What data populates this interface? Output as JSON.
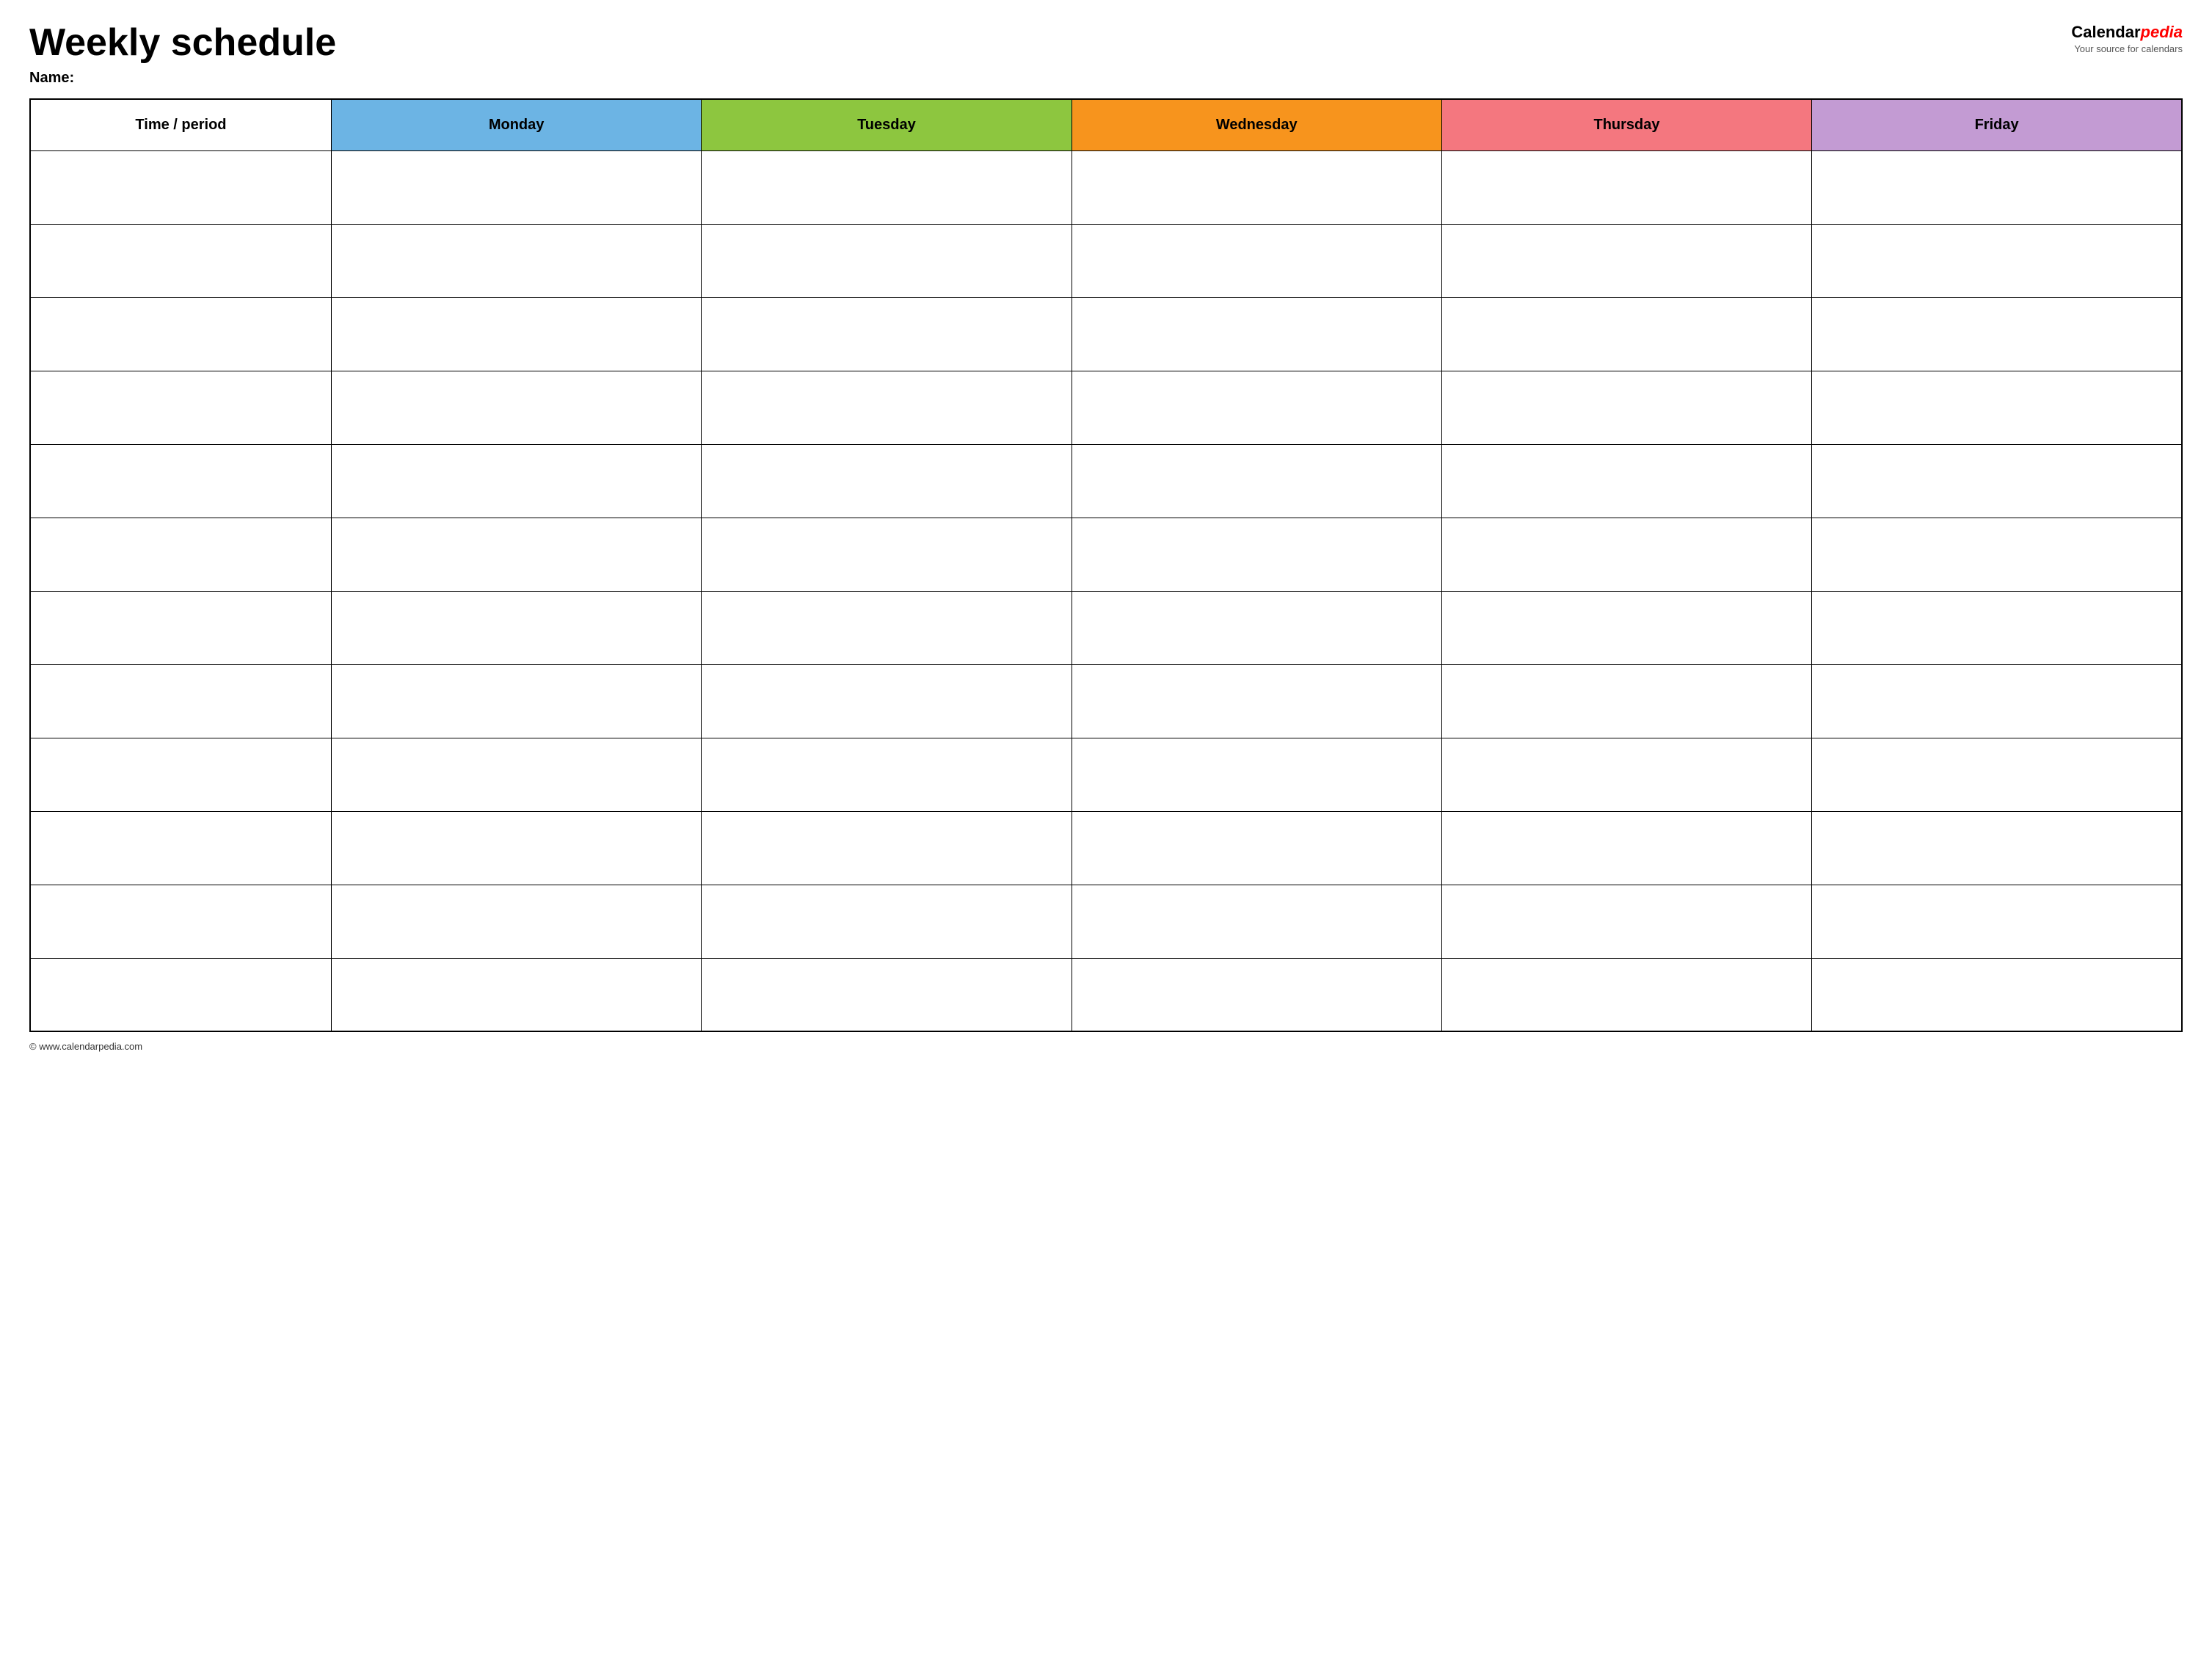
{
  "header": {
    "title": "Weekly schedule",
    "name_label": "Name:",
    "logo": {
      "calendar_text": "Calendar",
      "pedia_text": "pedia",
      "tagline": "Your source for calendars"
    }
  },
  "table": {
    "columns": [
      {
        "id": "time",
        "label": "Time / period",
        "color": "#ffffff"
      },
      {
        "id": "monday",
        "label": "Monday",
        "color": "#6cb4e4"
      },
      {
        "id": "tuesday",
        "label": "Tuesday",
        "color": "#8dc63f"
      },
      {
        "id": "wednesday",
        "label": "Wednesday",
        "color": "#f7941d"
      },
      {
        "id": "thursday",
        "label": "Thursday",
        "color": "#f4777f"
      },
      {
        "id": "friday",
        "label": "Friday",
        "color": "#c39bd3"
      }
    ],
    "row_count": 12
  },
  "footer": {
    "url": "© www.calendarpedia.com"
  }
}
